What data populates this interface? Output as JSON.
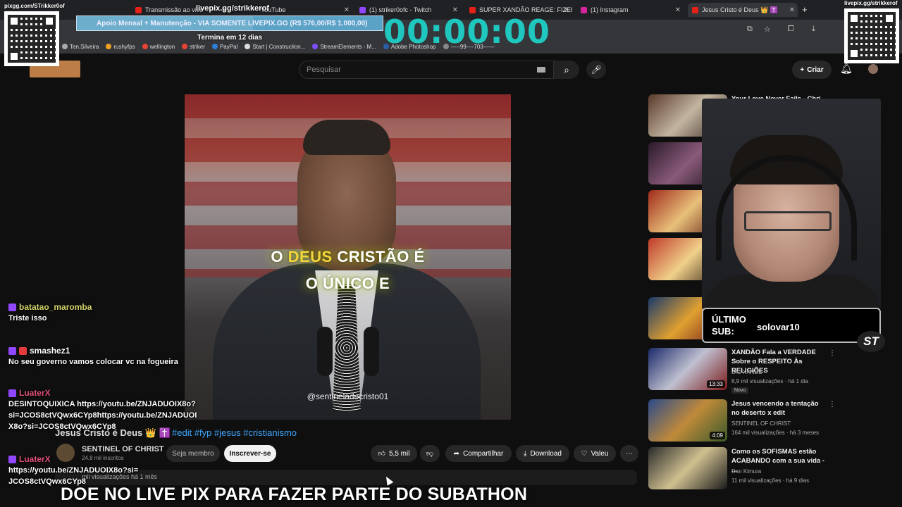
{
  "browser": {
    "tabs": [
      {
        "label": "Transmissão ao vivo",
        "color": "#e62117"
      },
      {
        "label": "YouTube",
        "color": "#e62117"
      },
      {
        "label": "(1) striker0ofc - Twitch",
        "color": "#9146ff"
      },
      {
        "label": "SUPER XANDÃO REAGE: FIZER/",
        "color": "#e62117"
      },
      {
        "label": "(1) Instagram",
        "color": "#d6249f"
      },
      {
        "label": "Jesus Cristo é Deus 👑 ✝️",
        "color": "#e62117"
      }
    ],
    "bookmarks": [
      "Ten.Silveira",
      "rushyfps",
      "wellington",
      "striker",
      "PayPal",
      "Start | Construction...",
      "StreamElements - M...",
      "Adobe Photoshop",
      "-----99----703------"
    ]
  },
  "overlay": {
    "qr_left_label": "pixgg.com/STrikker0of",
    "qr_right_label": "livepix.gg/strikkerof",
    "livepix_top": "livepix.gg/strikkerof",
    "goal_text": "Apoio Mensal + Manutenção - VIA SOMENTE LIVEPIX.GG (R$ 576,00/R$ 1.000,00)",
    "goal_progress": 0.576,
    "goal_ends": "Termina em 12 dias",
    "timer": "00:00:00",
    "last_sub_label_1": "ÚLTIMO",
    "last_sub_label_2": "SUB:",
    "last_sub_name": "solovar10",
    "st_logo": "ST",
    "banner": "DOE NO LIVE PIX PARA FAZER PARTE DO SUBATHON"
  },
  "chat": [
    {
      "user": "batatao_maromba",
      "user_color": "#d4d46a",
      "message": "Triste isso"
    },
    {
      "user": "smashez1",
      "user_color": "#ffffff",
      "message": "No seu governo vamos colocar vc na fogueira"
    },
    {
      "user": "LuaterX",
      "user_color": "#e0507a",
      "message": "DESINTOQUIXICA https://youtu.be/ZNJADUOIX8o?si=JCOS8ctVQwx6CYp8https://youtu.be/ZNJADUOIX8o?si=JCOS8ctVQwx6CYp8"
    },
    {
      "user": "LuaterX",
      "user_color": "#e0507a",
      "message": "https://youtu.be/ZNJADUOIX8o?si=JCOS8ctVQwx6CYp8"
    }
  ],
  "youtube": {
    "search_placeholder": "Pesquisar",
    "create_label": "Criar",
    "video_caption_line1_pre": "O",
    "video_caption_line1_hl": "DEUS",
    "video_caption_line1_post": "CRISTÃO É",
    "video_caption_line2": "O ÚNICO E",
    "video_handle": "@sentineladecristo01",
    "video_title": "Jesus Cristo é Deus 👑 ✝️",
    "hashtags": "#edit #fyp #jesus #cristianismo",
    "channel_name": "SENTINEL OF CHRIST",
    "channel_subs": "24,8 mil inscritos",
    "member_label": "Seja membro",
    "subscribe_label": "Inscrever-se",
    "likes": "5,5 mil",
    "share_label": "Compartilhar",
    "download_label": "Download",
    "thanks_label": "Valeu",
    "desc_meta": "mil visualizações  há 1 mês",
    "recommended": [
      {
        "title": "Your Love Never Fails - Chri...",
        "channel": "",
        "meta": "",
        "duration": ""
      },
      {
        "title": "",
        "channel": "",
        "meta": "",
        "duration": ""
      },
      {
        "title": "",
        "channel": "",
        "meta": "",
        "duration": ""
      },
      {
        "title": "",
        "channel": "",
        "meta": "",
        "duration": ""
      },
      {
        "title": "",
        "channel": "",
        "meta": "",
        "duration": ""
      },
      {
        "title": "XANDÃO Fala a VERDADE Sobre o RESPEITO Às RELIGIÕES",
        "channel": "BIG XANDE",
        "meta": "8,9 mil visualizações · há 1 dia",
        "duration": "13:33",
        "badge": "Novo"
      },
      {
        "title": "Jesus vencendo a tentação no deserto x edit",
        "channel": "SENTINEL OF CHRIST",
        "meta": "164 mil visualizações · há 3 meses",
        "duration": "4:09"
      },
      {
        "title": "Como os SOFISMAS estão ACABANDO com a sua vida - ...",
        "channel": "Dan Kimura",
        "meta": "11 mil visualizações · há 9 dias",
        "duration": ""
      }
    ]
  }
}
